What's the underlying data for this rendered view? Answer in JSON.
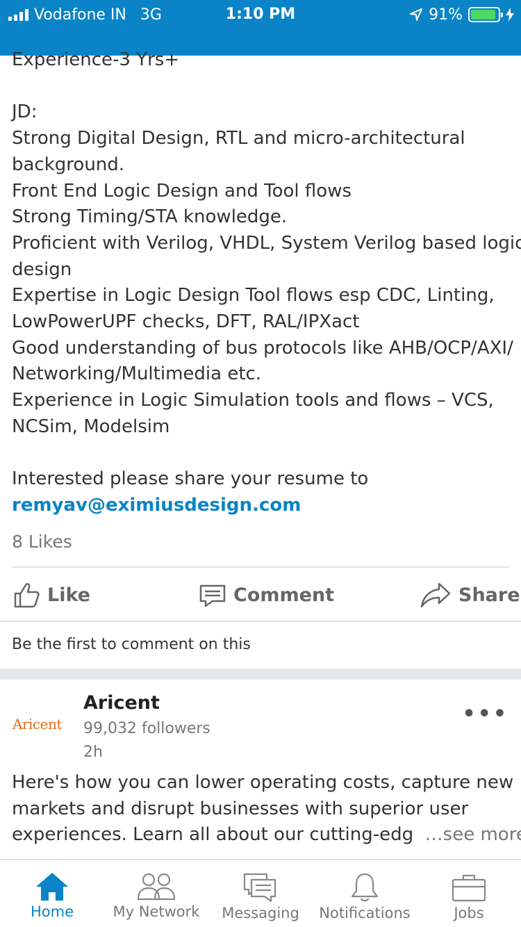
{
  "status_bar": {
    "carrier": "Vodafone IN",
    "network": "3G",
    "time": "1:10 PM",
    "battery": "91%",
    "battery_level": 0.91
  },
  "post": {
    "lines": [
      "Experience-3 Yrs+",
      "",
      "JD:",
      "Strong Digital Design, RTL and micro-architectural",
      "background.",
      "Front End Logic Design and Tool flows",
      "Strong Timing/STA knowledge.",
      "Proficient with Verilog, VHDL, System Verilog based logic",
      "design",
      "Expertise in Logic Design Tool flows esp CDC, Linting,",
      "LowPowerUPF checks, DFT, RAL/IPXact",
      "Good understanding of bus protocols like AHB/OCP/AXI/",
      "Networking/Multimedia etc.",
      "Experience in Logic Simulation tools and flows – VCS,",
      "NCSim, Modelsim",
      "",
      "Interested please share your resume to"
    ],
    "email": "remyav@eximiusdesign.com",
    "likes": "8 Likes"
  },
  "actions": {
    "like": "Like",
    "comment": "Comment",
    "share": "Share"
  },
  "first_comment": "Be the first to comment on this",
  "post2": {
    "logo_text": "Aricent",
    "company": "Aricent",
    "followers": "99,032 followers",
    "time": "2h",
    "lines": [
      "Here's how you can lower operating costs, capture new",
      "markets and disrupt businesses with superior user",
      "experiences. Learn all about our cutting-edg"
    ],
    "see_more": "…see more"
  },
  "tabs": [
    {
      "label": "Home",
      "icon": "home-icon",
      "active": true
    },
    {
      "label": "My Network",
      "icon": "network-icon",
      "active": false
    },
    {
      "label": "Messaging",
      "icon": "messaging-icon",
      "active": false
    },
    {
      "label": "Notifications",
      "icon": "bell-icon",
      "active": false
    },
    {
      "label": "Jobs",
      "icon": "briefcase-icon",
      "active": false
    }
  ],
  "colors": {
    "brand_blue": "#0A84C6",
    "battery_green": "#4CD964",
    "aricent_orange": "#E06A1A"
  }
}
